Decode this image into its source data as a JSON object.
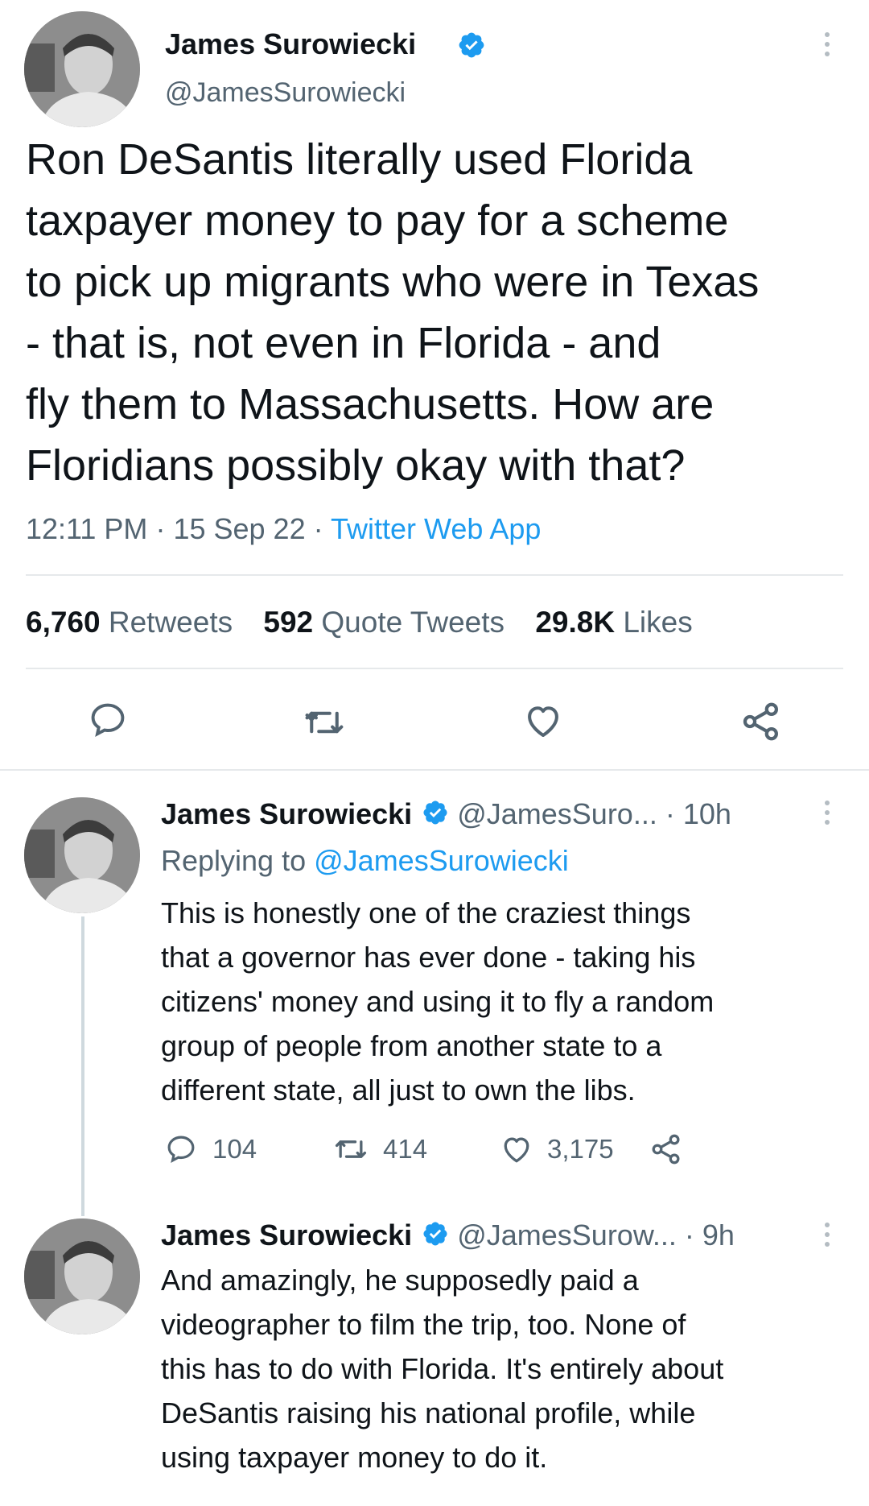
{
  "main_tweet": {
    "author_name": "James Surowiecki",
    "handle": "@JamesSurowiecki",
    "text_lines": [
      "Ron DeSantis literally used Florida",
      "taxpayer money to pay for a scheme",
      "to pick up migrants who were in Texas",
      "- that is, not even in Florida - and",
      "fly them to Massachusetts. How are",
      "Floridians possibly okay with that?"
    ],
    "time": "12:11 PM",
    "date": "15 Sep 22",
    "separator": "·",
    "source": "Twitter Web App",
    "stats": {
      "retweets_num": "6,760",
      "retweets_label": "Retweets",
      "quotes_num": "592",
      "quotes_label": "Quote Tweets",
      "likes_num": "29.8K",
      "likes_label": "Likes"
    },
    "icons": [
      "reply-icon",
      "retweet-icon",
      "like-icon",
      "share-icon"
    ]
  },
  "reply1": {
    "author_name": "James Surowiecki",
    "handle": "@JamesSuro...",
    "time": "· 10h",
    "replying_prefix": "Replying to",
    "replying_handle": "@JamesSurowiecki",
    "text_lines": [
      "This is honestly one of the craziest things",
      "that a governor has ever done - taking his",
      "citizens' money and using it to fly a random",
      "group of people from another state to a",
      "different state, all just to own the libs."
    ],
    "replies": "104",
    "retweets": "414",
    "likes": "3,175"
  },
  "reply2": {
    "author_name": "James Surowiecki",
    "handle": "@JamesSurow...",
    "time": "· 9h",
    "text_lines": [
      "And amazingly, he supposedly paid a",
      "videographer to film the trip, too. None of",
      "this has to do with Florida. It's entirely about",
      "DeSantis raising his national profile, while",
      "using taxpayer money to do it."
    ]
  },
  "colors": {
    "accent": "#1d9bf0",
    "text": "#0f1419",
    "muted": "#536471",
    "divider": "#e6e9eb"
  }
}
